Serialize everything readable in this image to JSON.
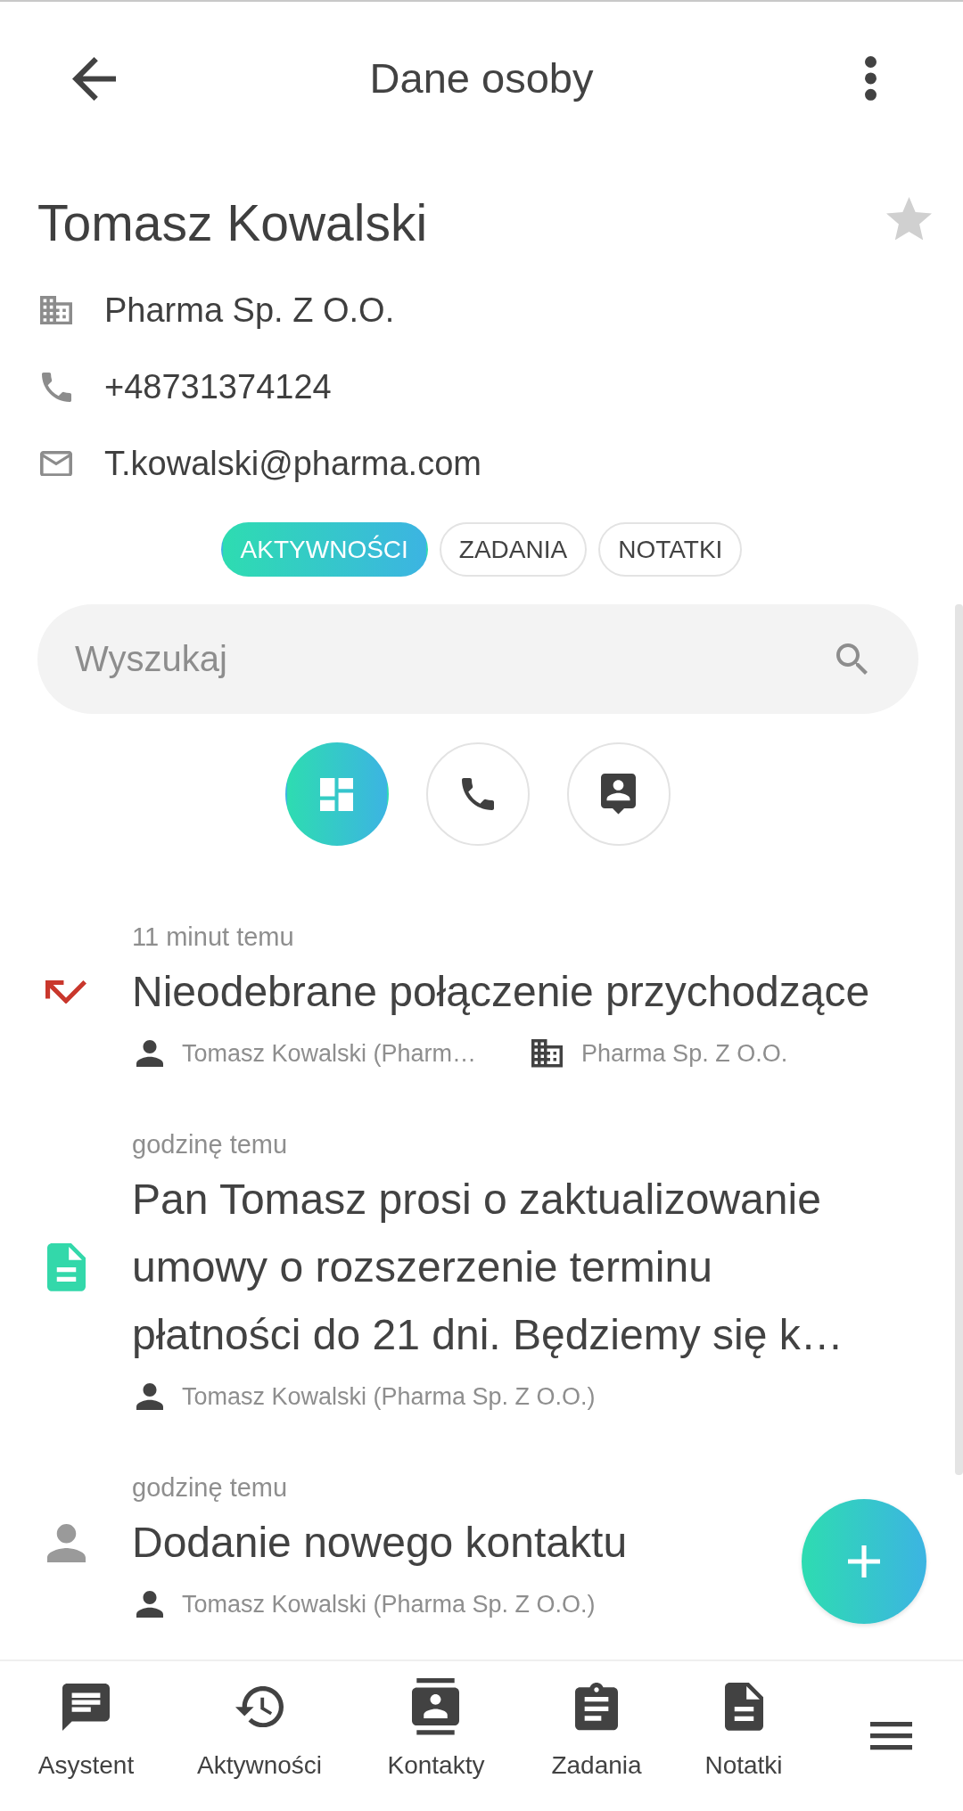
{
  "header": {
    "title": "Dane osoby"
  },
  "contact": {
    "name": "Tomasz Kowalski",
    "favorite": false,
    "details": [
      {
        "kind": "company",
        "text": "Pharma Sp. Z O.O."
      },
      {
        "kind": "phone",
        "text": "+48731374124"
      },
      {
        "kind": "email",
        "text": "T.kowalski@pharma.com"
      }
    ]
  },
  "tabs": [
    {
      "label": "AKTYWNOŚCI",
      "selected": true
    },
    {
      "label": "ZADANIA",
      "selected": false
    },
    {
      "label": "NOTATKI",
      "selected": false
    }
  ],
  "search": {
    "placeholder": "Wyszukaj"
  },
  "filters": [
    {
      "kind": "all",
      "selected": true
    },
    {
      "kind": "calls",
      "selected": false
    },
    {
      "kind": "contacts",
      "selected": false
    }
  ],
  "activities": [
    {
      "kind": "missed-call",
      "time": "11 minut temu",
      "title": "Nieodebrane połączenie przychodzące",
      "meta": [
        {
          "kind": "person",
          "text": "Tomasz Kowalski (Pharm…"
        },
        {
          "kind": "company",
          "text": "Pharma Sp. Z O.O."
        }
      ]
    },
    {
      "kind": "note",
      "time": "godzinę temu",
      "title": "Pan Tomasz prosi o zaktualizowanie umowy o rozszerzenie terminu płatności do 21 dni. Będziemy się k…",
      "meta": [
        {
          "kind": "person",
          "text": "Tomasz Kowalski (Pharma Sp. Z O.O.)"
        }
      ]
    },
    {
      "kind": "contact",
      "time": "godzinę temu",
      "title": "Dodanie nowego kontaktu",
      "meta": [
        {
          "kind": "person",
          "text": "Tomasz Kowalski (Pharma Sp. Z O.O.)"
        }
      ]
    }
  ],
  "bottom_nav": [
    {
      "kind": "assistant",
      "label": "Asystent"
    },
    {
      "kind": "activities",
      "label": "Aktywności"
    },
    {
      "kind": "contacts",
      "label": "Kontakty"
    },
    {
      "kind": "tasks",
      "label": "Zadania"
    },
    {
      "kind": "notes",
      "label": "Notatki"
    },
    {
      "kind": "menu"
    }
  ]
}
